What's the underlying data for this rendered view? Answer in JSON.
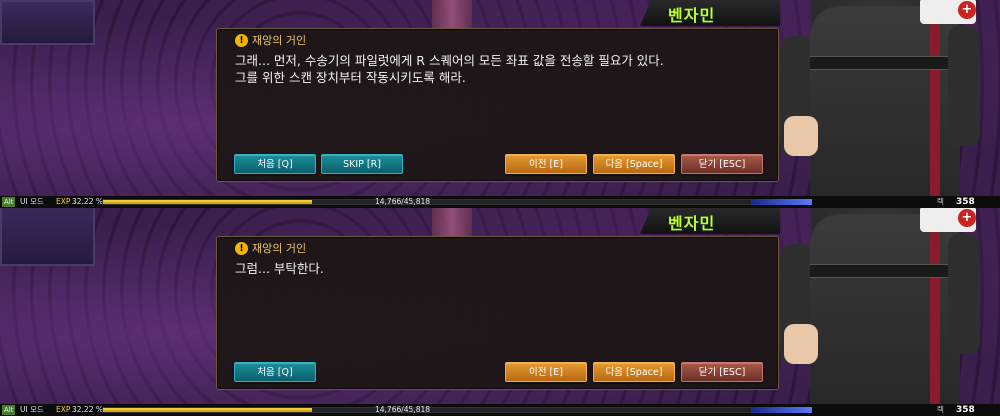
{
  "panels": [
    {
      "speaker_name": "벤자민",
      "dialog_title": "재앙의 거인",
      "dialog_text": "그래... 먼저, 수송기의 파일럿에게 R 스퀘어의 모든 좌표 값을 전송할 필요가 있다.\n그를 위한 스캔 장치부터 작동시키도록 해라.",
      "buttons": {
        "first": "처음 [Q]",
        "skip": "SKIP [R]",
        "prev": "이전 [E]",
        "next": "다음 [Space]",
        "close": "닫기 [ESC]"
      }
    },
    {
      "speaker_name": "벤자민",
      "dialog_title": "재앙의 거인",
      "dialog_text": "그럼... 부탁한다.",
      "buttons": {
        "first": "처음 [Q]",
        "prev": "이전 [E]",
        "next": "다음 [Space]",
        "close": "닫기 [ESC]"
      }
    }
  ],
  "statusbar": {
    "hotkey": "Alt",
    "ui_mode": "UI 모드",
    "exp_label": "EXP",
    "exp_percent": "32.22 %",
    "exp_fraction": 0.3222,
    "exp_values": "14,766/45,818",
    "level_tag": "렉",
    "level_value": "358"
  },
  "colors": {
    "speaker_name": "#b8ff3a",
    "dialog_title": "#e6c46a",
    "teal_button": "#1d8f9a",
    "orange_button": "#e59a32",
    "red_button": "#a85a4a",
    "exp_bar": "#ffd84a"
  },
  "icons": {
    "warning": "warning-icon"
  }
}
